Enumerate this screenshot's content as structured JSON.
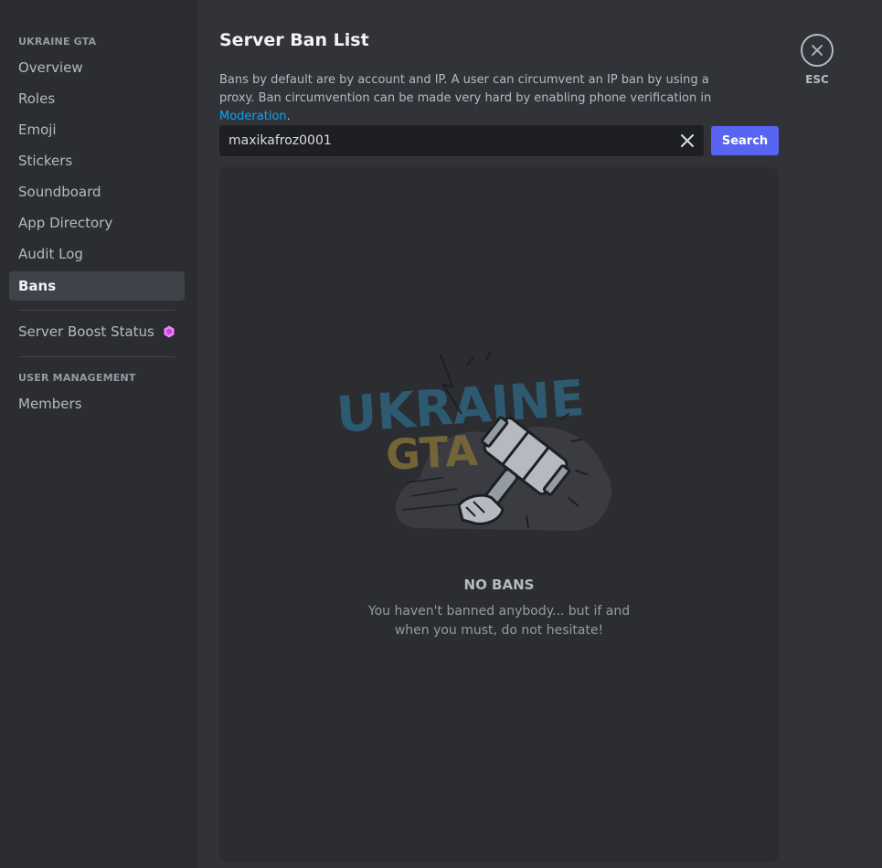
{
  "sidebar": {
    "server_header": "UKRAINE GTA",
    "items": [
      {
        "label": "Overview"
      },
      {
        "label": "Roles"
      },
      {
        "label": "Emoji"
      },
      {
        "label": "Stickers"
      },
      {
        "label": "Soundboard"
      },
      {
        "label": "App Directory"
      },
      {
        "label": "Audit Log"
      },
      {
        "label": "Bans",
        "active": true
      }
    ],
    "boost_item": {
      "label": "Server Boost Status",
      "icon": "boost-gem-icon",
      "icon_color": "#f47fff"
    },
    "user_mgmt_header": "USER MANAGEMENT",
    "members_item": {
      "label": "Members"
    }
  },
  "main": {
    "title": "Server Ban List",
    "description": "Bans by default are by account and IP. A user can circumvent an IP ban by using a proxy. Ban circumvention can be made very hard by enabling phone verification in ",
    "description_link": "Moderation",
    "description_end": ".",
    "search": {
      "value": "maxikafroz0001",
      "button_label": "Search"
    },
    "close": {
      "label": "ESC"
    },
    "empty_state": {
      "title": "NO BANS",
      "text": "You haven't banned anybody... but if and when you must, do not hesitate!",
      "watermark": "UKRAINE GTA"
    }
  },
  "colors": {
    "sidebar_bg": "#2b2d31",
    "main_bg": "#313338",
    "active_item_bg": "#404249",
    "accent": "#5865f2",
    "link": "#00a8fc"
  }
}
